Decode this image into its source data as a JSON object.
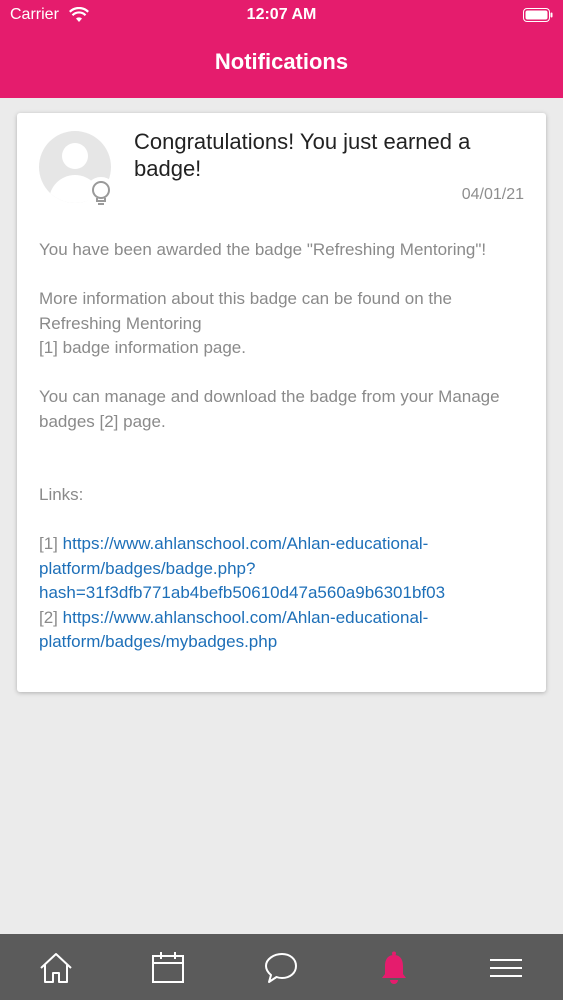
{
  "status_bar": {
    "carrier": "Carrier",
    "time": "12:07 AM",
    "wifi_icon": "wifi-icon",
    "battery_icon": "battery-icon"
  },
  "header": {
    "title": "Notifications",
    "background": "#e51c6d"
  },
  "notification": {
    "avatar_icon": "user-avatar-icon",
    "badge_icon": "lightbulb-icon",
    "subject": "Congratulations! You just earned a badge!",
    "date": "04/01/21",
    "body": {
      "line1": "You have been awarded the badge \"Refreshing Mentoring\"!",
      "line2": "More information about this badge can be found on the Refreshing Mentoring",
      "line3": "[1] badge information page.",
      "line4": "You can manage and download the badge from your Manage badges [2] page.",
      "links_label": "Links:",
      "link1_ref": "[1]",
      "link1_url": "https://www.ahlanschool.com/Ahlan-educational-platform/badges/badge.php?hash=31f3dfb771ab4befb50610d47a560a9b6301bf03",
      "link2_ref": "[2]",
      "link2_url": "https://www.ahlanschool.com/Ahlan-educational-platform/badges/mybadges.php"
    },
    "link_color": "#1d6fb8"
  },
  "tabbar": {
    "tabs": [
      {
        "icon": "home-icon"
      },
      {
        "icon": "calendar-icon"
      },
      {
        "icon": "chat-icon"
      },
      {
        "icon": "bell-icon",
        "active": true
      },
      {
        "icon": "menu-icon"
      }
    ],
    "active_color": "#e51c6d"
  }
}
